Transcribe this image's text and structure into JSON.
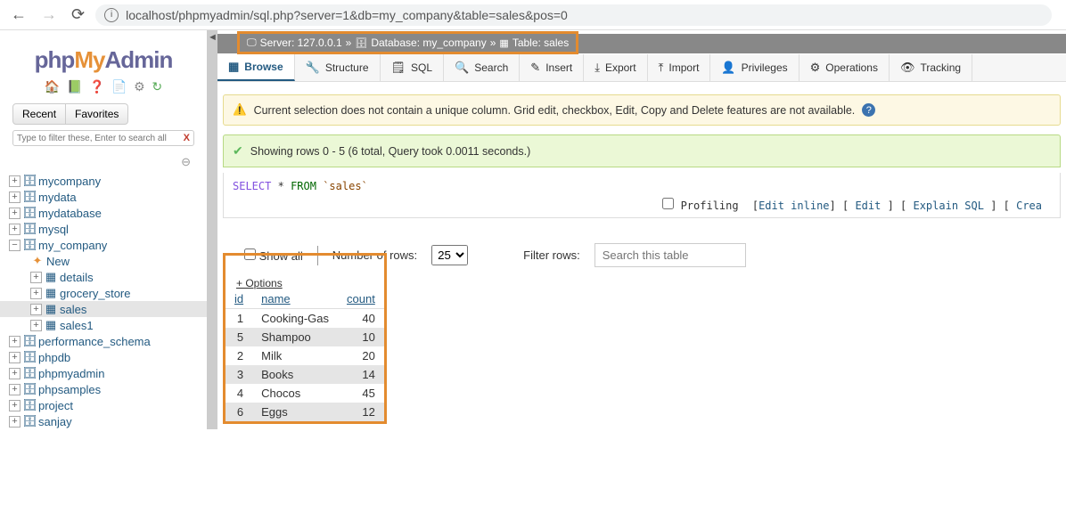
{
  "url": "localhost/phpmyadmin/sql.php?server=1&db=my_company&table=sales&pos=0",
  "logo": {
    "p1": "php",
    "p2": "My",
    "p3": "Admin"
  },
  "sidebar": {
    "recent": "Recent",
    "favorites": "Favorites",
    "filter_placeholder": "Type to filter these, Enter to search all",
    "tree": [
      {
        "label": "mycompany",
        "level": 1,
        "icon": "db"
      },
      {
        "label": "mydata",
        "level": 1,
        "icon": "db"
      },
      {
        "label": "mydatabase",
        "level": 1,
        "icon": "db"
      },
      {
        "label": "mysql",
        "level": 1,
        "icon": "db"
      },
      {
        "label": "my_company",
        "level": 1,
        "icon": "db",
        "expanded": true
      },
      {
        "label": "New",
        "level": 2,
        "icon": "new"
      },
      {
        "label": "details",
        "level": 2,
        "icon": "tbl"
      },
      {
        "label": "grocery_store",
        "level": 2,
        "icon": "tbl"
      },
      {
        "label": "sales",
        "level": 2,
        "icon": "tbl",
        "selected": true
      },
      {
        "label": "sales1",
        "level": 2,
        "icon": "tbl"
      },
      {
        "label": "performance_schema",
        "level": 1,
        "icon": "db"
      },
      {
        "label": "phpdb",
        "level": 1,
        "icon": "db"
      },
      {
        "label": "phpmyadmin",
        "level": 1,
        "icon": "db"
      },
      {
        "label": "phpsamples",
        "level": 1,
        "icon": "db"
      },
      {
        "label": "project",
        "level": 1,
        "icon": "db"
      },
      {
        "label": "sanjay",
        "level": 1,
        "icon": "db"
      }
    ]
  },
  "breadcrumb": {
    "server": "Server: 127.0.0.1",
    "database": "Database: my_company",
    "table": "Table: sales"
  },
  "topnav": [
    {
      "label": "Browse",
      "active": true
    },
    {
      "label": "Structure"
    },
    {
      "label": "SQL"
    },
    {
      "label": "Search"
    },
    {
      "label": "Insert"
    },
    {
      "label": "Export"
    },
    {
      "label": "Import"
    },
    {
      "label": "Privileges"
    },
    {
      "label": "Operations"
    },
    {
      "label": "Tracking"
    }
  ],
  "warning": "Current selection does not contain a unique column. Grid edit, checkbox, Edit, Copy and Delete features are not available.",
  "success": "Showing rows 0 - 5 (6 total, Query took 0.0011 seconds.)",
  "query": {
    "select": "SELECT",
    "star": "*",
    "from": "FROM",
    "table": "`sales`"
  },
  "query_links": {
    "profiling": "Profiling",
    "l1": "Edit inline",
    "l2": "Edit",
    "l3": "Explain SQL",
    "l4": "Crea"
  },
  "controls": {
    "show_all": "Show all",
    "rows_label": "Number of rows:",
    "rows_value": "25",
    "filter_label": "Filter rows:",
    "filter_placeholder": "Search this table"
  },
  "options": "+ Options",
  "table": {
    "headers": [
      "id",
      "name",
      "count"
    ],
    "rows": [
      {
        "id": "1",
        "name": "Cooking-Gas",
        "count": "40"
      },
      {
        "id": "5",
        "name": "Shampoo",
        "count": "10"
      },
      {
        "id": "2",
        "name": "Milk",
        "count": "20"
      },
      {
        "id": "3",
        "name": "Books",
        "count": "14"
      },
      {
        "id": "4",
        "name": "Chocos",
        "count": "45"
      },
      {
        "id": "6",
        "name": "Eggs",
        "count": "12"
      }
    ]
  }
}
